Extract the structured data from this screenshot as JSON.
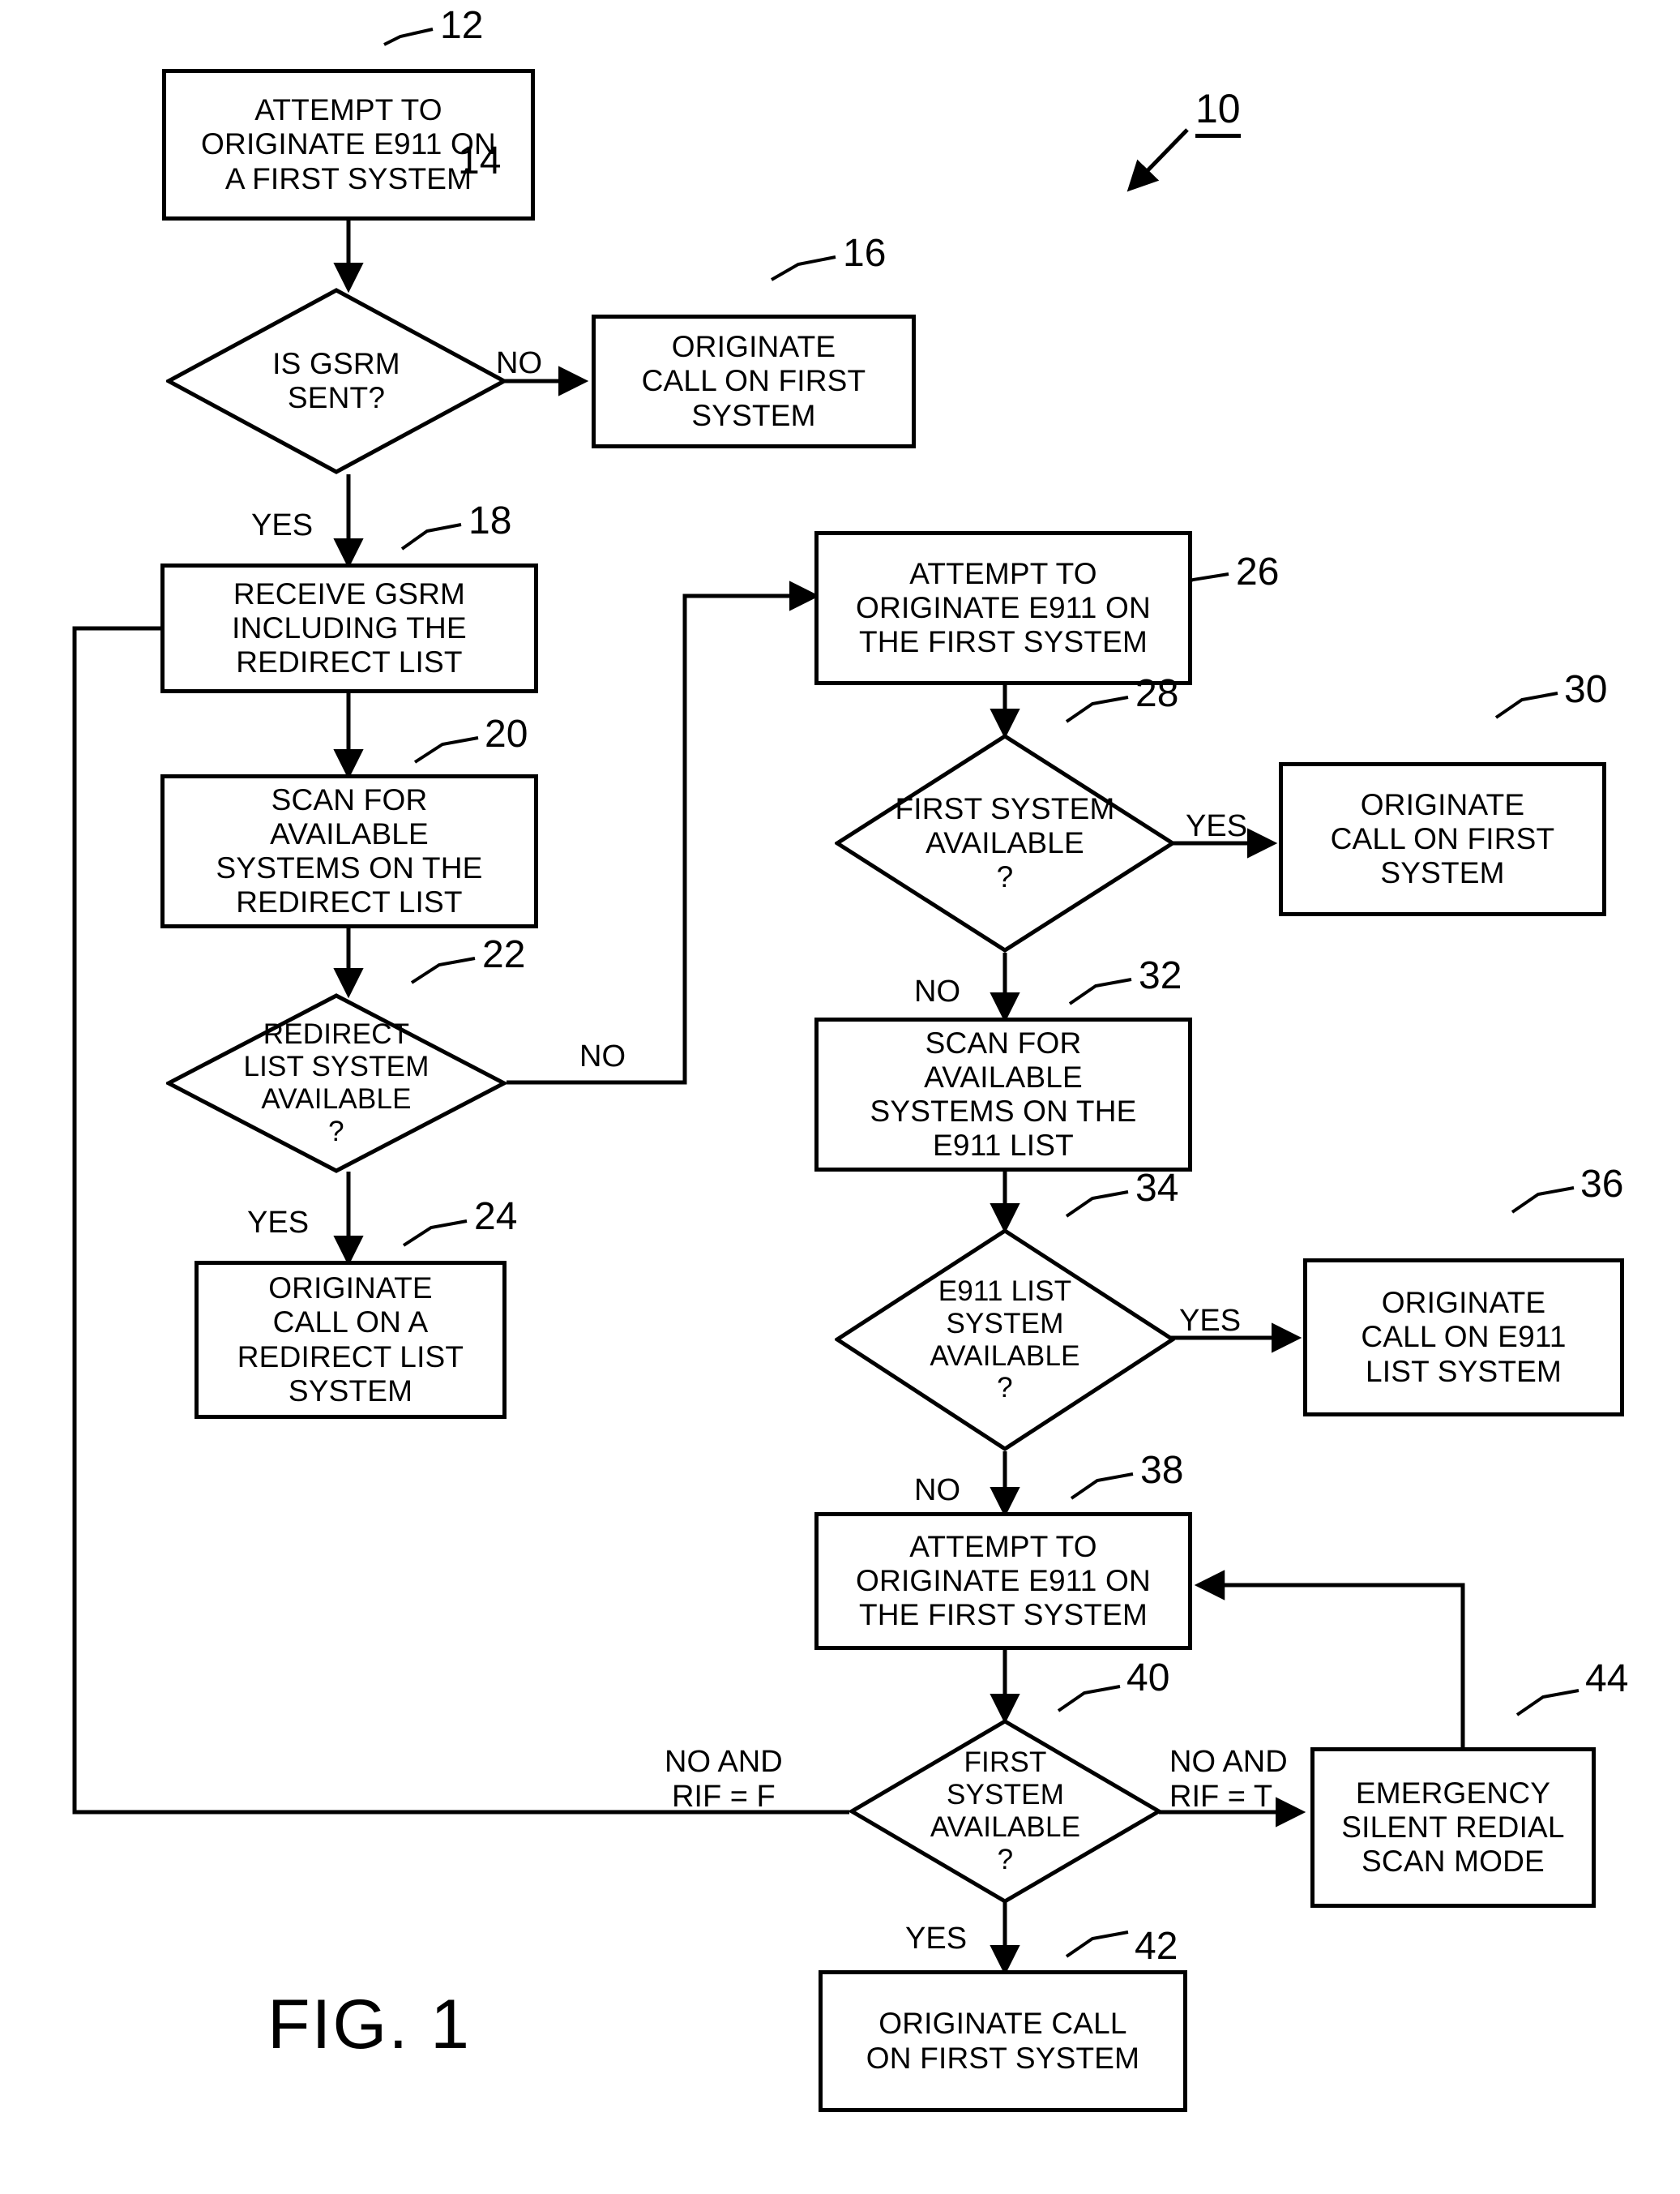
{
  "figure": {
    "caption": "FIG. 1",
    "diagram_ref": "10"
  },
  "chart_data": {
    "type": "diagram",
    "title": "FIG. 1",
    "diagram_kind": "flowchart",
    "diagram_ref": "10",
    "nodes": [
      {
        "ref": "12",
        "shape": "process",
        "text": "ATTEMPT TO ORIGINATE E911 ON A FIRST SYSTEM"
      },
      {
        "ref": "14",
        "shape": "decision",
        "text": "IS GSRM SENT?"
      },
      {
        "ref": "16",
        "shape": "process",
        "text": "ORIGINATE CALL ON FIRST SYSTEM"
      },
      {
        "ref": "18",
        "shape": "process",
        "text": "RECEIVE GSRM INCLUDING THE REDIRECT LIST"
      },
      {
        "ref": "20",
        "shape": "process",
        "text": "SCAN FOR AVAILABLE SYSTEMS ON THE REDIRECT LIST"
      },
      {
        "ref": "22",
        "shape": "decision",
        "text": "REDIRECT LIST SYSTEM AVAILABLE ?"
      },
      {
        "ref": "24",
        "shape": "process",
        "text": "ORIGINATE CALL ON A REDIRECT LIST SYSTEM"
      },
      {
        "ref": "26",
        "shape": "process",
        "text": "ATTEMPT TO ORIGINATE E911 ON THE FIRST SYSTEM"
      },
      {
        "ref": "28",
        "shape": "decision",
        "text": "FIRST SYSTEM AVAILABLE ?"
      },
      {
        "ref": "30",
        "shape": "process",
        "text": "ORIGINATE CALL ON FIRST SYSTEM"
      },
      {
        "ref": "32",
        "shape": "process",
        "text": "SCAN FOR AVAILABLE SYSTEMS ON THE E911 LIST"
      },
      {
        "ref": "34",
        "shape": "decision",
        "text": "E911 LIST SYSTEM AVAILABLE ?"
      },
      {
        "ref": "36",
        "shape": "process",
        "text": "ORIGINATE CALL ON E911 LIST SYSTEM"
      },
      {
        "ref": "38",
        "shape": "process",
        "text": "ATTEMPT TO ORIGINATE E911 ON THE FIRST SYSTEM"
      },
      {
        "ref": "40",
        "shape": "decision",
        "text": "FIRST SYSTEM AVAILABLE ?"
      },
      {
        "ref": "42",
        "shape": "process",
        "text": "ORIGINATE CALL ON FIRST SYSTEM"
      },
      {
        "ref": "44",
        "shape": "process",
        "text": "EMERGENCY SILENT REDIAL SCAN MODE"
      }
    ],
    "edges": [
      {
        "from": "12",
        "to": "14",
        "label": ""
      },
      {
        "from": "14",
        "to": "16",
        "label": "NO"
      },
      {
        "from": "14",
        "to": "18",
        "label": "YES"
      },
      {
        "from": "18",
        "to": "20",
        "label": ""
      },
      {
        "from": "20",
        "to": "22",
        "label": ""
      },
      {
        "from": "22",
        "to": "26",
        "label": "NO"
      },
      {
        "from": "22",
        "to": "24",
        "label": "YES"
      },
      {
        "from": "26",
        "to": "28",
        "label": ""
      },
      {
        "from": "28",
        "to": "30",
        "label": "YES"
      },
      {
        "from": "28",
        "to": "32",
        "label": "NO"
      },
      {
        "from": "32",
        "to": "34",
        "label": ""
      },
      {
        "from": "34",
        "to": "36",
        "label": "YES"
      },
      {
        "from": "34",
        "to": "38",
        "label": "NO"
      },
      {
        "from": "38",
        "to": "40",
        "label": ""
      },
      {
        "from": "40",
        "to": "18",
        "label": "NO AND RIF = F"
      },
      {
        "from": "40",
        "to": "44",
        "label": "NO AND RIF = T"
      },
      {
        "from": "40",
        "to": "42",
        "label": "YES"
      },
      {
        "from": "44",
        "to": "38",
        "label": ""
      }
    ]
  },
  "nodes": {
    "n12": {
      "text": "ATTEMPT TO\nORIGINATE E911 ON\nA FIRST SYSTEM",
      "ref": "12"
    },
    "n14": {
      "text": "IS GSRM\nSENT?",
      "ref": "14"
    },
    "n16": {
      "text": "ORIGINATE\nCALL ON FIRST\nSYSTEM",
      "ref": "16"
    },
    "n18": {
      "text": "RECEIVE GSRM\nINCLUDING THE\nREDIRECT LIST",
      "ref": "18"
    },
    "n20": {
      "text": "SCAN FOR\nAVAILABLE\nSYSTEMS ON THE\nREDIRECT LIST",
      "ref": "20"
    },
    "n22": {
      "text": "REDIRECT\nLIST SYSTEM\nAVAILABLE\n?",
      "ref": "22"
    },
    "n24": {
      "text": "ORIGINATE\nCALL ON A\nREDIRECT LIST\nSYSTEM",
      "ref": "24"
    },
    "n26": {
      "text": "ATTEMPT TO\nORIGINATE E911 ON\nTHE FIRST SYSTEM",
      "ref": "26"
    },
    "n28": {
      "text": "FIRST SYSTEM\nAVAILABLE\n?",
      "ref": "28"
    },
    "n30": {
      "text": "ORIGINATE\nCALL ON FIRST\nSYSTEM",
      "ref": "30"
    },
    "n32": {
      "text": "SCAN FOR\nAVAILABLE\nSYSTEMS ON THE\nE911 LIST",
      "ref": "32"
    },
    "n34": {
      "text": "E911 LIST\nSYSTEM\nAVAILABLE\n?",
      "ref": "34"
    },
    "n36": {
      "text": "ORIGINATE\nCALL ON E911\nLIST SYSTEM",
      "ref": "36"
    },
    "n38": {
      "text": "ATTEMPT TO\nORIGINATE E911 ON\nTHE FIRST SYSTEM",
      "ref": "38"
    },
    "n40": {
      "text": "FIRST\nSYSTEM\nAVAILABLE\n?",
      "ref": "40"
    },
    "n42": {
      "text": "ORIGINATE CALL\nON FIRST SYSTEM",
      "ref": "42"
    },
    "n44": {
      "text": "EMERGENCY\nSILENT REDIAL\nSCAN MODE",
      "ref": "44"
    }
  },
  "edge_labels": {
    "e14_no": "NO",
    "e14_yes": "YES",
    "e22_no": "NO",
    "e22_yes": "YES",
    "e28_yes": "YES",
    "e28_no": "NO",
    "e34_yes": "YES",
    "e34_no": "NO",
    "e40_left": "NO AND\nRIF = F",
    "e40_right": "NO AND\nRIF = T",
    "e40_yes": "YES"
  },
  "colors": {
    "ink": "#000000",
    "paper": "#ffffff"
  }
}
